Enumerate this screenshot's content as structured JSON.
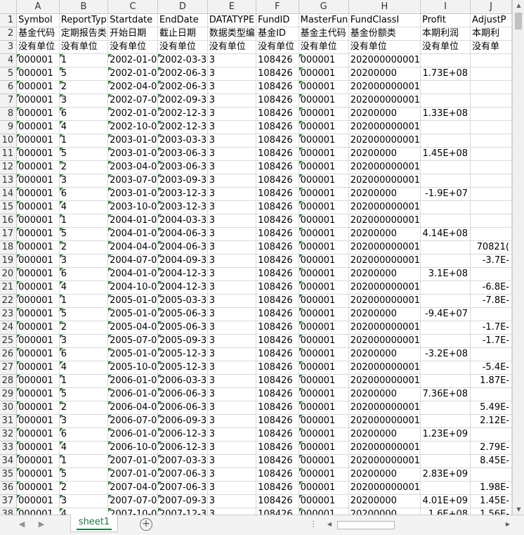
{
  "columns": [
    "A",
    "B",
    "C",
    "D",
    "E",
    "F",
    "G",
    "H",
    "I",
    "J"
  ],
  "rows": [
    [
      "1",
      "Symbol",
      "ReportTyp",
      "Startdate",
      "EndDate",
      "DATATYPE",
      "FundID",
      "MasterFun",
      "FundClassI",
      "Profit",
      "AdjustP"
    ],
    [
      "2",
      "基金代码",
      "定期报告类",
      "开始日期",
      "截止日期",
      "数据类型编",
      "基金ID",
      "基金主代码",
      "基金份额类",
      "本期利润",
      "本期利"
    ],
    [
      "3",
      "没有单位",
      "没有单位",
      "没有单位",
      "没有单位",
      "没有单位",
      "没有单位",
      "没有单位",
      "没有单位",
      "没有单位",
      "没有单"
    ],
    [
      "4",
      "000001",
      "1",
      "2002-01-0",
      "2002-03-3",
      "3",
      "108426",
      "000001",
      "202000000001",
      "",
      ""
    ],
    [
      "5",
      "000001",
      "5",
      "2002-01-0",
      "2002-06-3",
      "3",
      "108426",
      "000001",
      "20200000",
      "1.73E+08",
      ""
    ],
    [
      "6",
      "000001",
      "2",
      "2002-04-0",
      "2002-06-3",
      "3",
      "108426",
      "000001",
      "202000000001",
      "",
      ""
    ],
    [
      "7",
      "000001",
      "3",
      "2002-07-0",
      "2002-09-3",
      "3",
      "108426",
      "000001",
      "202000000001",
      "",
      ""
    ],
    [
      "8",
      "000001",
      "6",
      "2002-01-0",
      "2002-12-3",
      "3",
      "108426",
      "000001",
      "20200000",
      "1.33E+08",
      ""
    ],
    [
      "9",
      "000001",
      "4",
      "2002-10-0",
      "2002-12-3",
      "3",
      "108426",
      "000001",
      "202000000001",
      "",
      ""
    ],
    [
      "10",
      "000001",
      "1",
      "2003-01-0",
      "2003-03-3",
      "3",
      "108426",
      "000001",
      "202000000001",
      "",
      ""
    ],
    [
      "11",
      "000001",
      "5",
      "2003-01-0",
      "2003-06-3",
      "3",
      "108426",
      "000001",
      "20200000",
      "1.45E+08",
      ""
    ],
    [
      "12",
      "000001",
      "2",
      "2003-04-0",
      "2003-06-3",
      "3",
      "108426",
      "000001",
      "202000000001",
      "",
      ""
    ],
    [
      "13",
      "000001",
      "3",
      "2003-07-0",
      "2003-09-3",
      "3",
      "108426",
      "000001",
      "202000000001",
      "",
      ""
    ],
    [
      "14",
      "000001",
      "6",
      "2003-01-0",
      "2003-12-3",
      "3",
      "108426",
      "000001",
      "20200000",
      "-1.9E+07",
      ""
    ],
    [
      "15",
      "000001",
      "4",
      "2003-10-0",
      "2003-12-3",
      "3",
      "108426",
      "000001",
      "202000000001",
      "",
      ""
    ],
    [
      "16",
      "000001",
      "1",
      "2004-01-0",
      "2004-03-3",
      "3",
      "108426",
      "000001",
      "202000000001",
      "",
      ""
    ],
    [
      "17",
      "000001",
      "5",
      "2004-01-0",
      "2004-06-3",
      "3",
      "108426",
      "000001",
      "20200000",
      "4.14E+08",
      ""
    ],
    [
      "18",
      "000001",
      "2",
      "2004-04-0",
      "2004-06-3",
      "3",
      "108426",
      "000001",
      "202000000001",
      "",
      "70821("
    ],
    [
      "19",
      "000001",
      "3",
      "2004-07-0",
      "2004-09-3",
      "3",
      "108426",
      "000001",
      "202000000001",
      "",
      "-3.7E-"
    ],
    [
      "20",
      "000001",
      "6",
      "2004-01-0",
      "2004-12-3",
      "3",
      "108426",
      "000001",
      "20200000",
      "3.1E+08",
      ""
    ],
    [
      "21",
      "000001",
      "4",
      "2004-10-0",
      "2004-12-3",
      "3",
      "108426",
      "000001",
      "202000000001",
      "",
      "-6.8E-"
    ],
    [
      "22",
      "000001",
      "1",
      "2005-01-0",
      "2005-03-3",
      "3",
      "108426",
      "000001",
      "202000000001",
      "",
      "-7.8E-"
    ],
    [
      "23",
      "000001",
      "5",
      "2005-01-0",
      "2005-06-3",
      "3",
      "108426",
      "000001",
      "20200000",
      "-9.4E+07",
      ""
    ],
    [
      "24",
      "000001",
      "2",
      "2005-04-0",
      "2005-06-3",
      "3",
      "108426",
      "000001",
      "202000000001",
      "",
      "-1.7E-"
    ],
    [
      "25",
      "000001",
      "3",
      "2005-07-0",
      "2005-09-3",
      "3",
      "108426",
      "000001",
      "202000000001",
      "",
      "-1.7E-"
    ],
    [
      "26",
      "000001",
      "6",
      "2005-01-0",
      "2005-12-3",
      "3",
      "108426",
      "000001",
      "20200000",
      "-3.2E+08",
      ""
    ],
    [
      "27",
      "000001",
      "4",
      "2005-10-0",
      "2005-12-3",
      "3",
      "108426",
      "000001",
      "202000000001",
      "",
      "-5.4E-"
    ],
    [
      "28",
      "000001",
      "1",
      "2006-01-0",
      "2006-03-3",
      "3",
      "108426",
      "000001",
      "202000000001",
      "",
      "1.87E-"
    ],
    [
      "29",
      "000001",
      "5",
      "2006-01-0",
      "2006-06-3",
      "3",
      "108426",
      "000001",
      "20200000",
      "7.36E+08",
      ""
    ],
    [
      "30",
      "000001",
      "2",
      "2006-04-0",
      "2006-06-3",
      "3",
      "108426",
      "000001",
      "202000000001",
      "",
      "5.49E-"
    ],
    [
      "31",
      "000001",
      "3",
      "2006-07-0",
      "2006-09-3",
      "3",
      "108426",
      "000001",
      "202000000001",
      "",
      "2.12E-"
    ],
    [
      "32",
      "000001",
      "6",
      "2006-01-0",
      "2006-12-3",
      "3",
      "108426",
      "000001",
      "20200000",
      "1.23E+09",
      ""
    ],
    [
      "33",
      "000001",
      "4",
      "2006-10-0",
      "2006-12-3",
      "3",
      "108426",
      "000001",
      "202000000001",
      "",
      "2.79E-"
    ],
    [
      "34",
      "000001",
      "1",
      "2007-01-0",
      "2007-03-3",
      "3",
      "108426",
      "000001",
      "202000000001",
      "",
      "8.45E-"
    ],
    [
      "35",
      "000001",
      "5",
      "2007-01-0",
      "2007-06-3",
      "3",
      "108426",
      "000001",
      "20200000",
      "2.83E+09",
      ""
    ],
    [
      "36",
      "000001",
      "2",
      "2007-04-0",
      "2007-06-3",
      "3",
      "108426",
      "000001",
      "202000000001",
      "",
      "1.98E-"
    ],
    [
      "37",
      "000001",
      "3",
      "2007-07-0",
      "2007-09-3",
      "3",
      "108426",
      "000001",
      "20200000",
      "4.01E+09",
      "1.45E-"
    ],
    [
      "38",
      "000001",
      "4",
      "2007-10-0",
      "2007-12-3",
      "3",
      "108426",
      "000001",
      "20200000",
      "1.6E+08",
      "1.56E-"
    ]
  ],
  "sheet_tab": "sheet1",
  "add_sheet_icon": "plus-circle-icon",
  "scroll_dots": "⋮"
}
